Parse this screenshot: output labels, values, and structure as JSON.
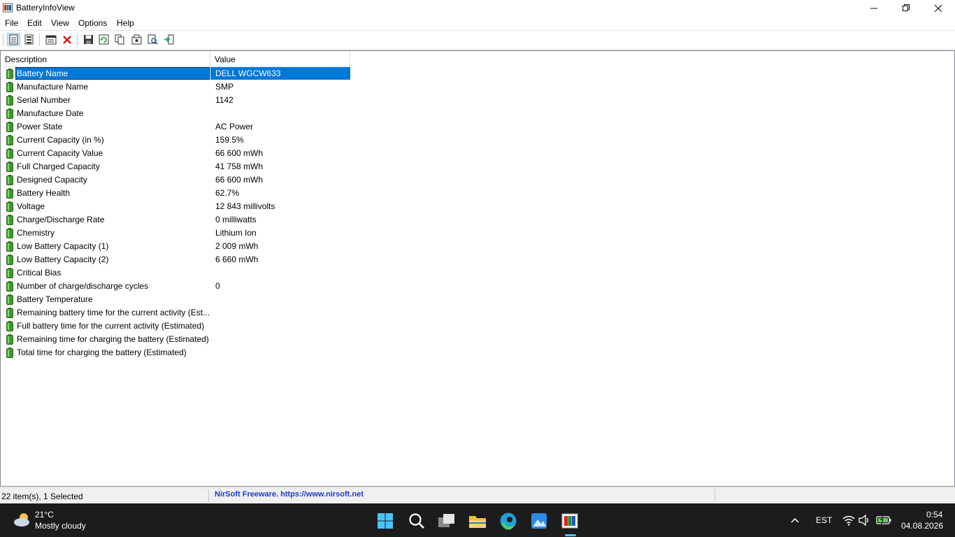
{
  "window": {
    "title": "BatteryInfoView"
  },
  "menu": [
    {
      "id": "file",
      "label": "File"
    },
    {
      "id": "edit",
      "label": "Edit"
    },
    {
      "id": "view",
      "label": "View"
    },
    {
      "id": "options",
      "label": "Options"
    },
    {
      "id": "help",
      "label": "Help"
    }
  ],
  "toolbar": {
    "icons": [
      "battery-info-mode-icon",
      "battery-log-mode-icon",
      "properties-icon",
      "delete-icon",
      "save-icon",
      "refresh-icon",
      "copy-icon",
      "options-icon",
      "find-icon",
      "exit-icon"
    ]
  },
  "columns": {
    "description": "Description",
    "value": "Value"
  },
  "rows": [
    {
      "description": "Battery Name",
      "value": "DELL WGCW633",
      "selected": true
    },
    {
      "description": "Manufacture Name",
      "value": "SMP"
    },
    {
      "description": "Serial Number",
      "value": "1142"
    },
    {
      "description": "Manufacture Date",
      "value": ""
    },
    {
      "description": "Power State",
      "value": "AC Power"
    },
    {
      "description": "Current Capacity (in %)",
      "value": "159.5%"
    },
    {
      "description": "Current Capacity Value",
      "value": "66 600 mWh"
    },
    {
      "description": "Full Charged Capacity",
      "value": "41 758 mWh"
    },
    {
      "description": "Designed Capacity",
      "value": "66 600 mWh"
    },
    {
      "description": "Battery Health",
      "value": "62.7%"
    },
    {
      "description": "Voltage",
      "value": "12 843 millivolts"
    },
    {
      "description": "Charge/Discharge Rate",
      "value": "0 milliwatts"
    },
    {
      "description": "Chemistry",
      "value": "Lithium Ion"
    },
    {
      "description": "Low Battery Capacity (1)",
      "value": "2 009 mWh"
    },
    {
      "description": "Low Battery Capacity (2)",
      "value": "6 660 mWh"
    },
    {
      "description": "Critical Bias",
      "value": ""
    },
    {
      "description": "Number of charge/discharge cycles",
      "value": "0"
    },
    {
      "description": "Battery Temperature",
      "value": ""
    },
    {
      "description": "Remaining battery time for the current activity (Est...",
      "value": ""
    },
    {
      "description": "Full battery time for the current activity (Estimated)",
      "value": ""
    },
    {
      "description": "Remaining time for charging the battery (Estimated)",
      "value": ""
    },
    {
      "description": "Total  time for charging the battery (Estimated)",
      "value": ""
    }
  ],
  "status": {
    "items": "22 item(s), 1 Selected",
    "link": "NirSoft Freeware. https://www.nirsoft.net"
  },
  "taskbar": {
    "weather": {
      "temp": "21°C",
      "condition": "Mostly cloudy"
    },
    "language": "EST",
    "time": "0:54",
    "date": "04.08.2026"
  },
  "colors": {
    "selection": "#0078d7",
    "battery_green": "#3c9a2a",
    "taskbar": "#1c1c1c"
  }
}
